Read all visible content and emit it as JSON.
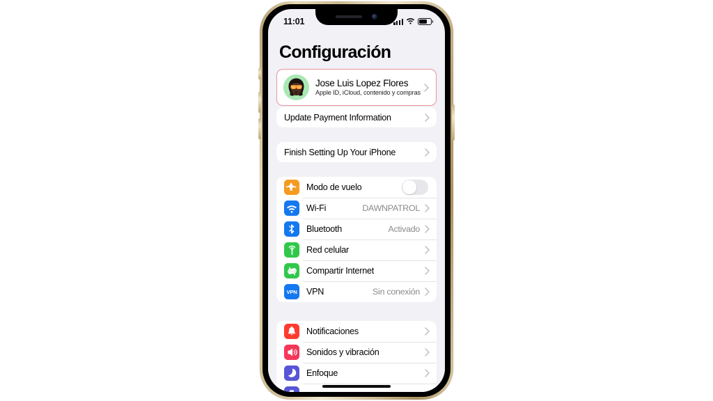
{
  "device": {
    "name": "iphone-12-gold",
    "frame_color": "#d3c19b",
    "bezel_color": "#000000",
    "screen_bg": "#f1f1f6"
  },
  "status_bar": {
    "time": "11:01",
    "cellular_icon": "cellular-bars-icon",
    "cellular_bars": 4,
    "wifi_icon": "wifi-icon",
    "battery_icon": "battery-icon",
    "battery_level_pct": 72
  },
  "header": {
    "title": "Configuración"
  },
  "apple_id": {
    "name": "Jose Luis Lopez Flores",
    "subtitle": "Apple ID, iCloud, contenido y compras",
    "avatar_name": "memoji-avatar",
    "avatar_bg": "#a9e8b4",
    "highlight_color": "#e8949c",
    "chevron": "chevron-right-icon"
  },
  "payment_section": {
    "rows": [
      {
        "label": "Update Payment Information",
        "chevron": "chevron-right-icon"
      }
    ]
  },
  "setup_section": {
    "rows": [
      {
        "label": "Finish Setting Up Your iPhone",
        "chevron": "chevron-right-icon"
      }
    ]
  },
  "connectivity_section": {
    "rows": [
      {
        "label": "Modo de vuelo",
        "icon": "airplane-icon",
        "icon_color": "#f59b22",
        "control": "toggle",
        "toggle_on": false,
        "value": ""
      },
      {
        "label": "Wi-Fi",
        "icon": "wifi-icon",
        "icon_color": "#1478f0",
        "control": "chevron",
        "value": "DAWNPATROL"
      },
      {
        "label": "Bluetooth",
        "icon": "bluetooth-icon",
        "icon_color": "#1478f0",
        "control": "chevron",
        "value": "Activado"
      },
      {
        "label": "Red celular",
        "icon": "cellular-antenna-icon",
        "icon_color": "#30c84b",
        "control": "chevron",
        "value": ""
      },
      {
        "label": "Compartir Internet",
        "icon": "hotspot-link-icon",
        "icon_color": "#30c84b",
        "control": "chevron",
        "value": ""
      },
      {
        "label": "VPN",
        "icon": "vpn-badge-icon",
        "icon_color": "#1478f0",
        "icon_text": "VPN",
        "control": "chevron",
        "value": "Sin conexión"
      }
    ]
  },
  "alerts_section": {
    "rows": [
      {
        "label": "Notificaciones",
        "icon": "bell-icon",
        "icon_color": "#ff3b30",
        "control": "chevron",
        "value": ""
      },
      {
        "label": "Sonidos y vibración",
        "icon": "speaker-waves-icon",
        "icon_color": "#f4375a",
        "control": "chevron",
        "value": ""
      },
      {
        "label": "Enfoque",
        "icon": "moon-icon",
        "icon_color": "#5856d6",
        "control": "chevron",
        "value": ""
      }
    ]
  },
  "partial_row": {
    "icon": "hourglass-icon",
    "icon_color": "#5856d6"
  },
  "home_indicator": {
    "name": "home-indicator"
  }
}
